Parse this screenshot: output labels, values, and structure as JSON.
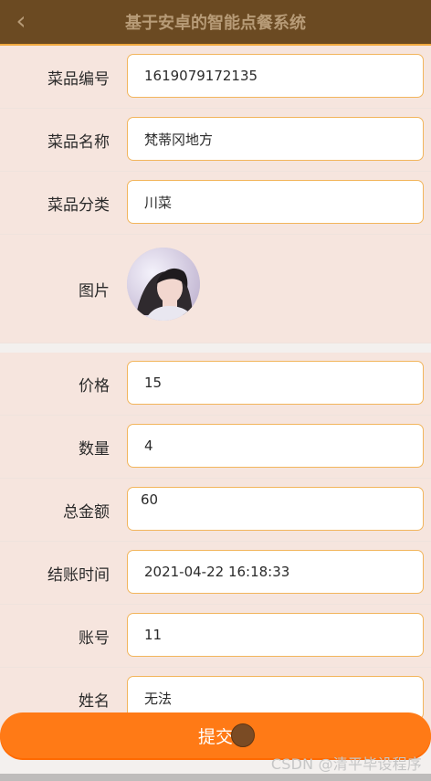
{
  "app": {
    "title": "基于安卓的智能点餐系统"
  },
  "fields": [
    {
      "label": "菜品编号",
      "value": "1619079172135"
    },
    {
      "label": "菜品名称",
      "value": "梵蒂冈地方"
    },
    {
      "label": "菜品分类",
      "value": "川菜"
    },
    {
      "label": "图片",
      "value": ""
    },
    {
      "label": "价格",
      "value": "15"
    },
    {
      "label": "数量",
      "value": "4"
    },
    {
      "label": "总金额",
      "value": "60"
    },
    {
      "label": "结账时间",
      "value": "2021-04-22 16:18:33"
    },
    {
      "label": "账号",
      "value": "11"
    },
    {
      "label": "姓名",
      "value": "无法"
    }
  ],
  "actions": {
    "submit_label": "提交"
  },
  "watermark": "CSDN @清平毕设程序",
  "icons": {
    "back": "chevron-left-icon"
  },
  "colors": {
    "header_bg": "#6b4a22",
    "accent": "#ff7a16",
    "input_border": "#f2b55c"
  }
}
